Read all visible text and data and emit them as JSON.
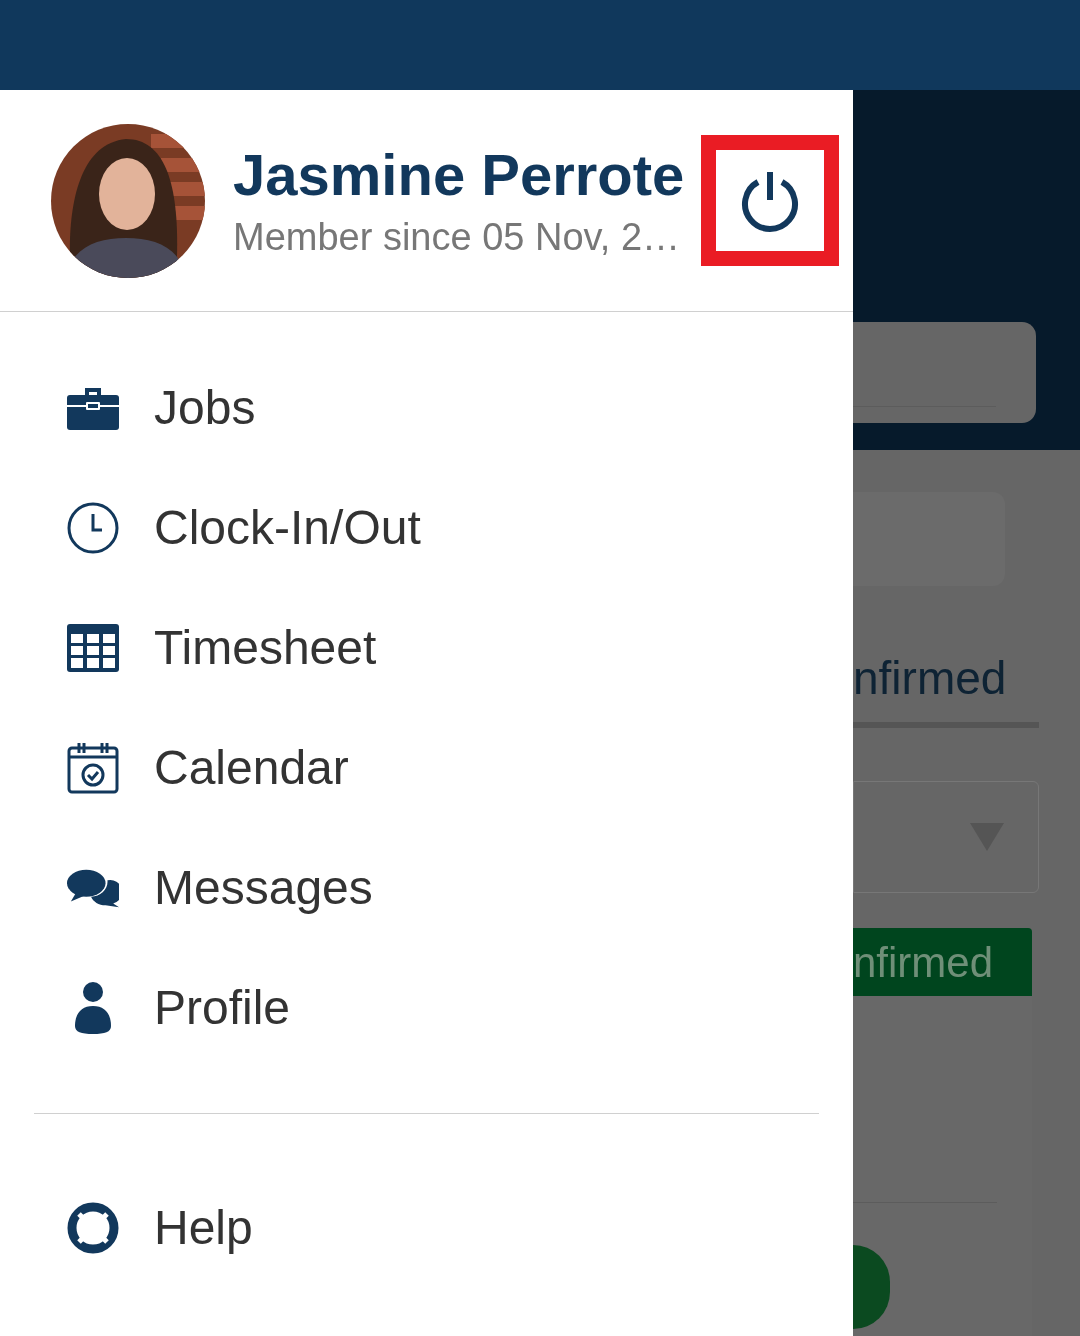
{
  "profile": {
    "name": "Jasmine Perrote",
    "member_since": "Member since 05 Nov, 2…",
    "logout_highlighted": true
  },
  "menu": [
    {
      "label": "Jobs",
      "kind": "briefcase"
    },
    {
      "label": "Clock-In/Out",
      "kind": "clock"
    },
    {
      "label": "Timesheet",
      "kind": "table"
    },
    {
      "label": "Calendar",
      "kind": "calendar"
    },
    {
      "label": "Messages",
      "kind": "chat"
    },
    {
      "label": "Profile",
      "kind": "person"
    }
  ],
  "footer_menu": [
    {
      "label": "Help",
      "kind": "lifebuoy"
    }
  ],
  "background": {
    "tab_label": "nfirmed",
    "status_badge": "nfirmed"
  }
}
